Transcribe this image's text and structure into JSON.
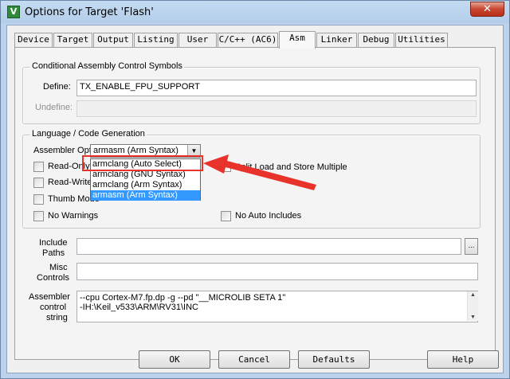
{
  "window": {
    "title": "Options for Target 'Flash'",
    "icon_letter": "V",
    "close_glyph": "✕"
  },
  "tabs": [
    {
      "label": "Device"
    },
    {
      "label": "Target"
    },
    {
      "label": "Output"
    },
    {
      "label": "Listing"
    },
    {
      "label": "User"
    },
    {
      "label": "C/C++ (AC6)"
    },
    {
      "label": "Asm",
      "active": true
    },
    {
      "label": "Linker"
    },
    {
      "label": "Debug"
    },
    {
      "label": "Utilities"
    }
  ],
  "conditional_group": {
    "title": "Conditional Assembly Control Symbols",
    "define_label": "Define:",
    "define_value": "TX_ENABLE_FPU_SUPPORT",
    "undefine_label": "Undefine:",
    "undefine_value": ""
  },
  "language_group": {
    "title": "Language / Code Generation",
    "assembler_option_label": "Assembler Option:",
    "assembler_option_value": "armasm (Arm Syntax)",
    "dropdown_options": [
      {
        "label": "armclang (Auto Select)",
        "selected": false
      },
      {
        "label": "armclang (GNU Syntax)",
        "selected": false
      },
      {
        "label": "armclang (Arm Syntax)",
        "selected": false
      },
      {
        "label": "armasm (Arm Syntax)",
        "selected": true
      }
    ],
    "read_only_label": "Read-Only Pos",
    "read_write_label": "Read-Write Pos",
    "thumb_mode_label": "Thumb Mode",
    "no_warnings_label": "No Warnings",
    "split_load_label": "Split Load and Store Multiple",
    "no_auto_includes_label": "No Auto Includes"
  },
  "include_paths": {
    "label_line1": "Include",
    "label_line2": "Paths",
    "value": "",
    "browse_label": "..."
  },
  "misc_controls": {
    "label_line1": "Misc",
    "label_line2": "Controls",
    "value": ""
  },
  "assembler_control": {
    "label_line1": "Assembler",
    "label_line2": "control",
    "label_line3": "string",
    "line1": "--cpu Cortex-M7.fp.dp -g --pd \"__MICROLIB SETA 1\"",
    "line2": "-IH:\\Keil_v533\\ARM\\RV31\\INC"
  },
  "buttons": {
    "ok": "OK",
    "cancel": "Cancel",
    "defaults": "Defaults",
    "help": "Help"
  },
  "colors": {
    "annotation_red": "#e8332a",
    "selection_blue": "#3399ff",
    "title_bar": "#b3cde9"
  },
  "icons": [
    "app-icon",
    "close-icon",
    "chevron-down-icon",
    "browse-icon",
    "scroll-up-icon",
    "scroll-down-icon"
  ]
}
